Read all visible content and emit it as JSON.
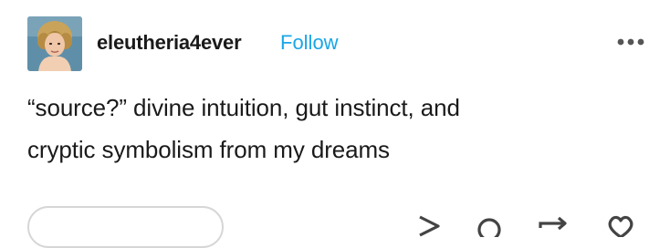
{
  "post": {
    "username": "eleutheria4ever",
    "follow_label": "Follow",
    "text_lines": [
      "“source?” divine intuition, gut instinct, and",
      "cryptic symbolism from my dreams"
    ]
  },
  "icons": {
    "more": "more-options-icon",
    "share": "share-icon",
    "reply": "reply-icon",
    "reblog": "reblog-icon",
    "like": "heart-icon"
  },
  "colors": {
    "accent": "#1aa6e6",
    "text": "#1a1a1a",
    "icon": "#555555"
  }
}
